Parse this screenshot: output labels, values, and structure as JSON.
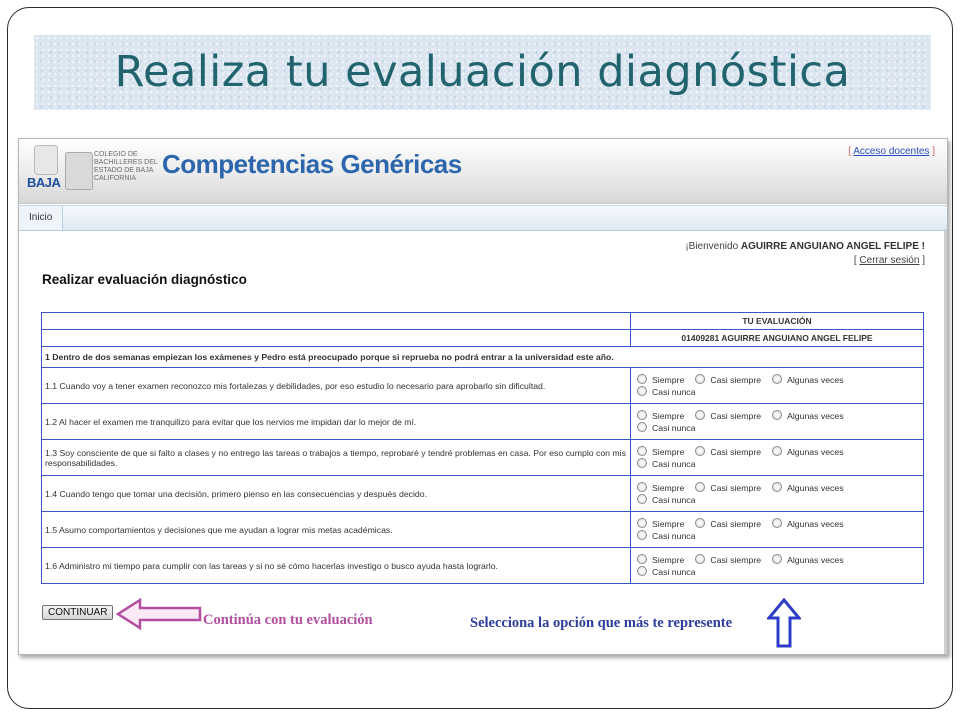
{
  "slide": {
    "title": "Realiza tu evaluación diagnóstica"
  },
  "app": {
    "logo_word": "BAJA",
    "institution": "COLEGIO DE BACHILLERES DEL ESTADO DE BAJA CALIFORNIA",
    "title": "Competencias Genéricas",
    "docentes_link": "Acceso docentes"
  },
  "nav": {
    "tabs": [
      "Inicio"
    ]
  },
  "user": {
    "welcome_prefix": "¡Bienvenido",
    "name": "AGUIRRE ANGUIANO ANGEL FELIPE !",
    "logout": "Cerrar sesión"
  },
  "page": {
    "heading": "Realizar evaluación diagnóstico"
  },
  "evaluation": {
    "column_header": "TU EVALUACIÓN",
    "student": "01409281 AGUIRRE ANGUIANO ANGEL FELIPE",
    "scenario": "1 Dentro de dos semanas empiezan los exámenes y Pedro está preocupado porque si repruebа no podrá entrar a la universidad este año.",
    "options": [
      "Siempre",
      "Casi siempre",
      "Algunas veces",
      "Casi nunca"
    ],
    "items": [
      "1.1 Cuando voy a tener examen reconozco mis fortalezas y debilidades, por eso estudio lo necesario para aprobarlo sin dificultad.",
      "1.2 Al hacer el examen me tranquilizo para evitar que los nervios me impidan dar lo mejor de mí.",
      "1.3 Soy consciente de que si falto a clases y no entrego las tareas o trabajos a tiempo, reprobaré y tendré problemas en casa. Por eso cumplo con mis responsabilidades.",
      "1.4 Cuando tengo que tomar una decisión, primero pienso en las consecuencias y después decido.",
      "1.5 Asumo comportamientos y decisiones que me ayudan a lograr mis metas académicas.",
      "1.6 Administro mi tiempo para cumplir con las tareas y si no sé cómo hacerlas investigo o busco ayuda hasta lograrlo."
    ]
  },
  "actions": {
    "continue_label": "CONTINUAR"
  },
  "annotations": {
    "continue_note": "Continúa con tu evaluación",
    "select_note": "Selecciona la opción que más te represente"
  },
  "colors": {
    "title": "#21646e",
    "link": "#2a4fbf",
    "table_border": "#3a55c8",
    "note_purple": "#b24fa0",
    "note_blue": "#2c3d9b"
  }
}
